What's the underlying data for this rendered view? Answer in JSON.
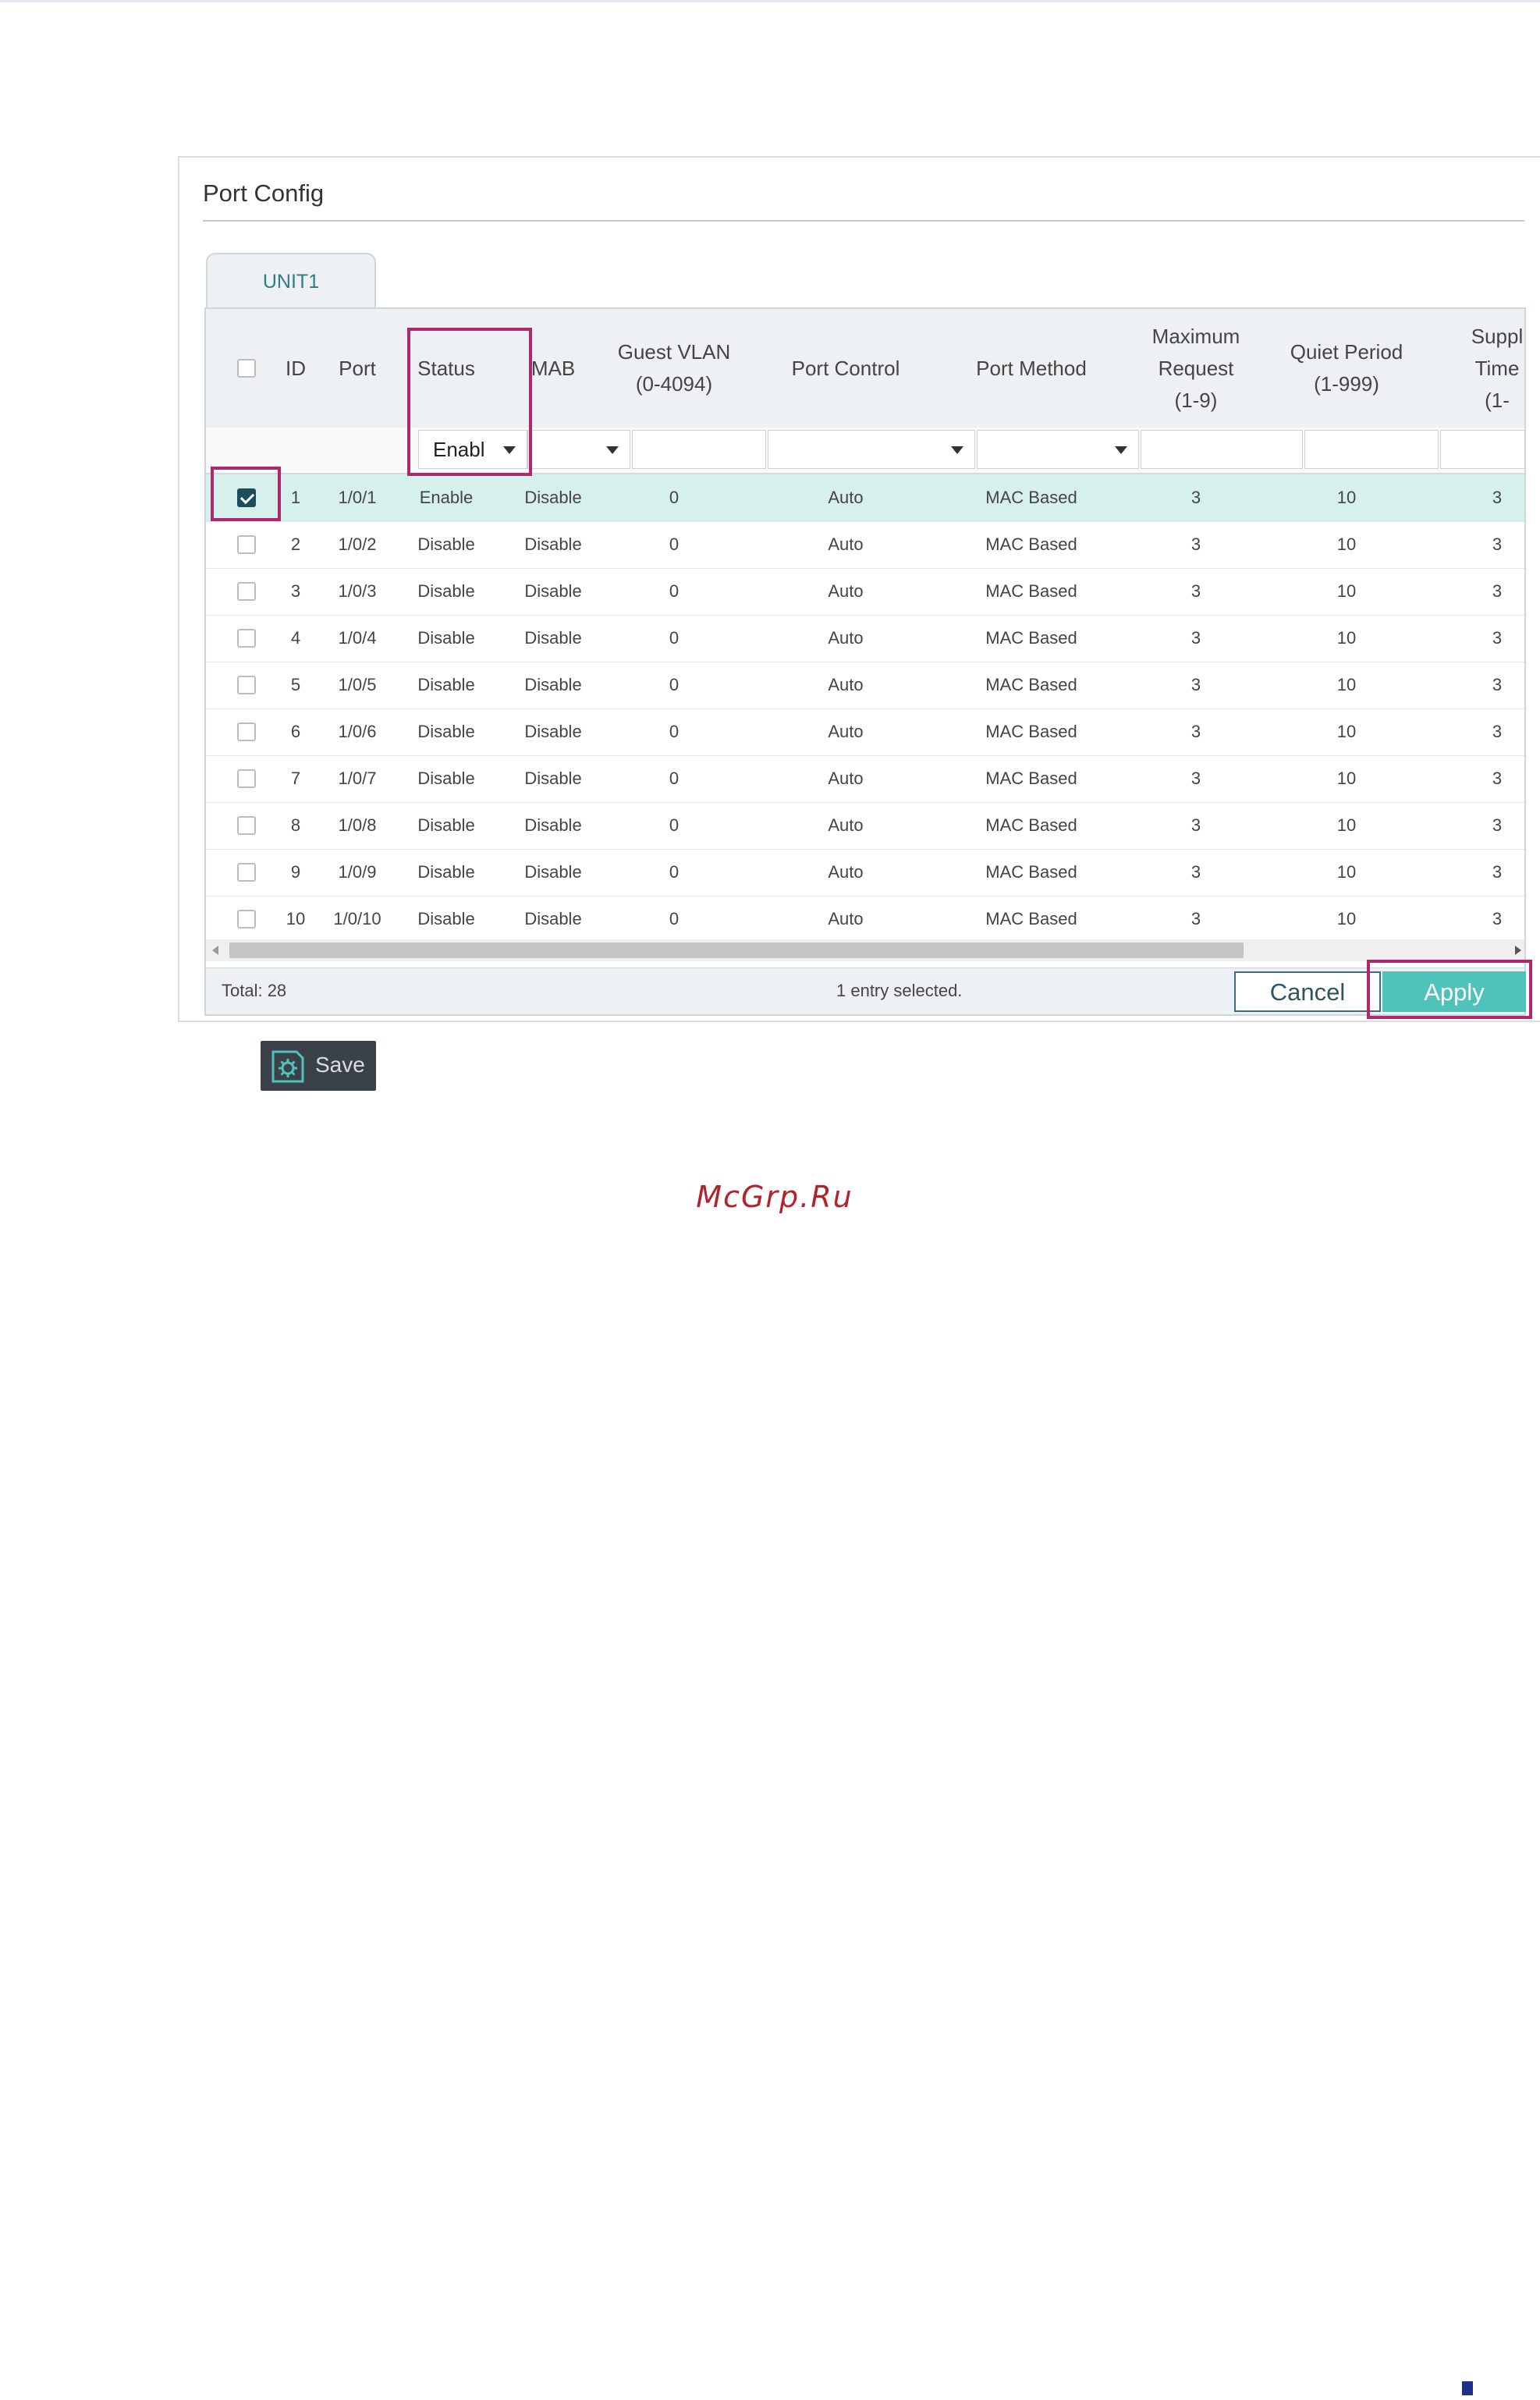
{
  "panel": {
    "title": "Port Config"
  },
  "tabs": [
    {
      "label": "UNIT1"
    }
  ],
  "columns": {
    "id": "ID",
    "port": "Port",
    "status": "Status",
    "mab": "MAB",
    "guest_vlan": "Guest VLAN\n(0-4094)",
    "port_control": "Port Control",
    "port_method": "Port Method",
    "max_request": "Maximum\nRequest\n(1-9)",
    "quiet_period": "Quiet Period\n(1-999)",
    "supplicant_timeout": "Suppl\nTime\n(1-"
  },
  "filters": {
    "status_value": "Enabl"
  },
  "rows": [
    {
      "checked": true,
      "id": "1",
      "port": "1/0/1",
      "status": "Enable",
      "mab": "Disable",
      "guest_vlan": "0",
      "port_control": "Auto",
      "port_method": "MAC Based",
      "max_request": "3",
      "quiet_period": "10",
      "supplicant_timeout": "3"
    },
    {
      "checked": false,
      "id": "2",
      "port": "1/0/2",
      "status": "Disable",
      "mab": "Disable",
      "guest_vlan": "0",
      "port_control": "Auto",
      "port_method": "MAC Based",
      "max_request": "3",
      "quiet_period": "10",
      "supplicant_timeout": "3"
    },
    {
      "checked": false,
      "id": "3",
      "port": "1/0/3",
      "status": "Disable",
      "mab": "Disable",
      "guest_vlan": "0",
      "port_control": "Auto",
      "port_method": "MAC Based",
      "max_request": "3",
      "quiet_period": "10",
      "supplicant_timeout": "3"
    },
    {
      "checked": false,
      "id": "4",
      "port": "1/0/4",
      "status": "Disable",
      "mab": "Disable",
      "guest_vlan": "0",
      "port_control": "Auto",
      "port_method": "MAC Based",
      "max_request": "3",
      "quiet_period": "10",
      "supplicant_timeout": "3"
    },
    {
      "checked": false,
      "id": "5",
      "port": "1/0/5",
      "status": "Disable",
      "mab": "Disable",
      "guest_vlan": "0",
      "port_control": "Auto",
      "port_method": "MAC Based",
      "max_request": "3",
      "quiet_period": "10",
      "supplicant_timeout": "3"
    },
    {
      "checked": false,
      "id": "6",
      "port": "1/0/6",
      "status": "Disable",
      "mab": "Disable",
      "guest_vlan": "0",
      "port_control": "Auto",
      "port_method": "MAC Based",
      "max_request": "3",
      "quiet_period": "10",
      "supplicant_timeout": "3"
    },
    {
      "checked": false,
      "id": "7",
      "port": "1/0/7",
      "status": "Disable",
      "mab": "Disable",
      "guest_vlan": "0",
      "port_control": "Auto",
      "port_method": "MAC Based",
      "max_request": "3",
      "quiet_period": "10",
      "supplicant_timeout": "3"
    },
    {
      "checked": false,
      "id": "8",
      "port": "1/0/8",
      "status": "Disable",
      "mab": "Disable",
      "guest_vlan": "0",
      "port_control": "Auto",
      "port_method": "MAC Based",
      "max_request": "3",
      "quiet_period": "10",
      "supplicant_timeout": "3"
    },
    {
      "checked": false,
      "id": "9",
      "port": "1/0/9",
      "status": "Disable",
      "mab": "Disable",
      "guest_vlan": "0",
      "port_control": "Auto",
      "port_method": "MAC Based",
      "max_request": "3",
      "quiet_period": "10",
      "supplicant_timeout": "3"
    },
    {
      "checked": false,
      "id": "10",
      "port": "1/0/10",
      "status": "Disable",
      "mab": "Disable",
      "guest_vlan": "0",
      "port_control": "Auto",
      "port_method": "MAC Based",
      "max_request": "3",
      "quiet_period": "10",
      "supplicant_timeout": "3"
    }
  ],
  "footer": {
    "total": "Total: 28",
    "selected": "1 entry selected.",
    "cancel_label": "Cancel",
    "apply_label": "Apply"
  },
  "save": {
    "label": "Save",
    "icon": "save-gear-icon"
  },
  "watermark": "McGrp.Ru",
  "colors": {
    "accent": "#4fc3bb",
    "highlight": "#b2266b",
    "selected_row": "#d6f1ec",
    "checkbox_checked": "#1e4d5e",
    "watermark": "#b3232d"
  }
}
